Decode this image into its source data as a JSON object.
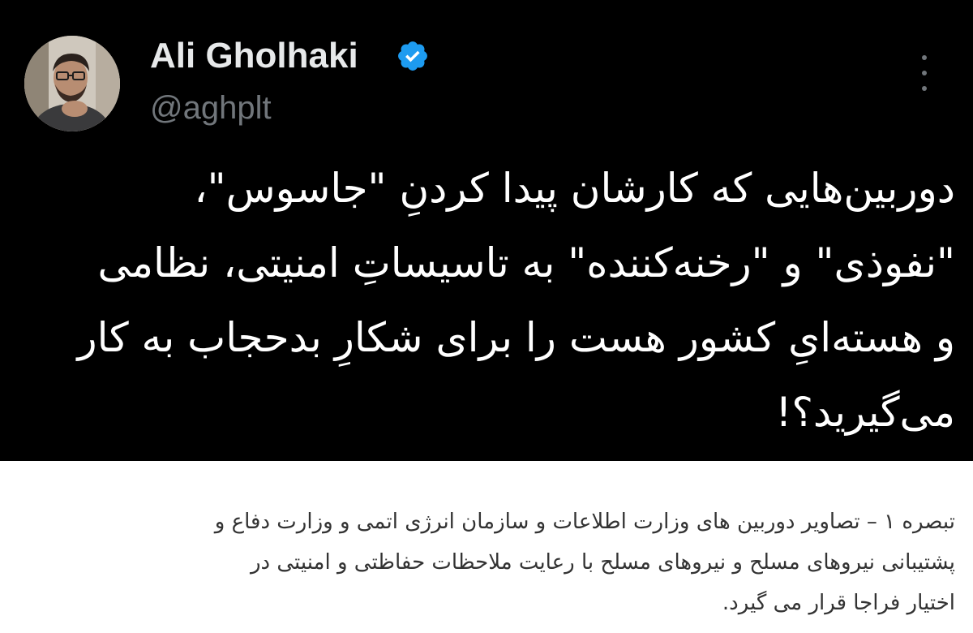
{
  "tweet": {
    "author": {
      "display_name": "Ali Gholhaki",
      "handle": "@aghplt",
      "verified": true,
      "avatar_icon": "profile-photo"
    },
    "more_icon": "vertical-ellipsis-icon",
    "text_lines": [
      "دوربین‌هایی که کارشان پیدا کردنِ \"جاسوس\"،",
      "\"نفوذی\" و \"رخنه‌کننده\" به تاسیساتِ امنیتی، نظامی",
      "و هسته‌ایِ کشور هست را برای شکارِ بدحجاب به کار",
      "می‌گیرید؟!"
    ]
  },
  "caption": {
    "lines": [
      "تبصره ۱ – تصاویر دوربین های وزارت اطلاعات و سازمان انرژی اتمی و وزارت دفاع و",
      "پشتیبانی نیروهای مسلح و نیروهای مسلح با رعایت ملاحظات حفاظتی و امنیتی در",
      "اختیار فراجا قرار می گیرد."
    ]
  },
  "colors": {
    "tweet_background": "#000000",
    "verified_badge": "#1d9bf0",
    "secondary_text": "#71767b",
    "caption_background": "#ffffff"
  }
}
